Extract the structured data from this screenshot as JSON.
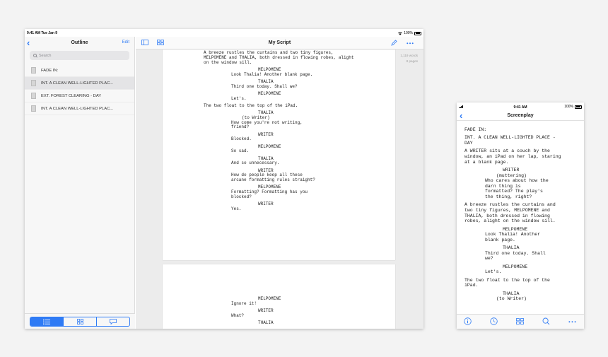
{
  "ipad": {
    "status": {
      "time": "9:41 AM  Tue Jan 9",
      "battery": "100%"
    },
    "sidebar": {
      "title": "Outline",
      "edit_label": "Edit",
      "search_placeholder": "Search",
      "items": [
        {
          "label": "FADE IN:"
        },
        {
          "label": "INT. A CLEAN WELL-LIGHTED PLAC..."
        },
        {
          "label": "EXT. FOREST CLEARING - DAY"
        },
        {
          "label": "INT. A CLEAN WELL-LIGHTED PLAC..."
        }
      ],
      "selected_index": 1,
      "segments": [
        "list-icon",
        "grid-icon",
        "comment-icon"
      ]
    },
    "main": {
      "title": "My Script",
      "stats": {
        "words": "1,119 words",
        "pages": "8 pages"
      },
      "page1": [
        {
          "text": "A breeze rustles the curtains and two tiny figures,",
          "type": "action"
        },
        {
          "text": "MELPOMENE and THALIA, both dressed in flowing robes, alight",
          "type": "action"
        },
        {
          "text": "on the window sill.",
          "type": "action"
        },
        {
          "text": "",
          "type": "blank"
        },
        {
          "text": "MELPOMENE",
          "type": "character"
        },
        {
          "text": "Look Thalia! Another blank page.",
          "type": "dialogue"
        },
        {
          "text": "",
          "type": "blank"
        },
        {
          "text": "THALIA",
          "type": "character"
        },
        {
          "text": "Third one today. Shall we?",
          "type": "dialogue"
        },
        {
          "text": "",
          "type": "blank"
        },
        {
          "text": "MELPOMENE",
          "type": "character"
        },
        {
          "text": "Let's.",
          "type": "dialogue"
        },
        {
          "text": "",
          "type": "blank"
        },
        {
          "text": "The two float to the top of the iPad.",
          "type": "action"
        },
        {
          "text": "",
          "type": "blank"
        },
        {
          "text": "THALIA",
          "type": "character"
        },
        {
          "text": "(to Writer)",
          "type": "paren"
        },
        {
          "text": "How come you're not writing,",
          "type": "dialogue"
        },
        {
          "text": "friend?",
          "type": "dialogue"
        },
        {
          "text": "",
          "type": "blank"
        },
        {
          "text": "WRITER",
          "type": "character"
        },
        {
          "text": "Blocked.",
          "type": "dialogue"
        },
        {
          "text": "",
          "type": "blank"
        },
        {
          "text": "MELPOMENE",
          "type": "character"
        },
        {
          "text": "So sad.",
          "type": "dialogue"
        },
        {
          "text": "",
          "type": "blank"
        },
        {
          "text": "THALIA",
          "type": "character"
        },
        {
          "text": "And so unnecessary.",
          "type": "dialogue"
        },
        {
          "text": "",
          "type": "blank"
        },
        {
          "text": "WRITER",
          "type": "character"
        },
        {
          "text": "How do people keep all these",
          "type": "dialogue"
        },
        {
          "text": "arcane formatting rules straight?",
          "type": "dialogue"
        },
        {
          "text": "",
          "type": "blank"
        },
        {
          "text": "MELPOMENE",
          "type": "character"
        },
        {
          "text": "Formatting? Formatting has you",
          "type": "dialogue"
        },
        {
          "text": "blocked?",
          "type": "dialogue"
        },
        {
          "text": "",
          "type": "blank"
        },
        {
          "text": "WRITER",
          "type": "character"
        },
        {
          "text": "Yes.",
          "type": "dialogue"
        }
      ],
      "page2": [
        {
          "text": "MELPOMENE",
          "type": "character"
        },
        {
          "text": "Ignore it!",
          "type": "dialogue"
        },
        {
          "text": "",
          "type": "blank"
        },
        {
          "text": "WRITER",
          "type": "character"
        },
        {
          "text": "What?",
          "type": "dialogue"
        },
        {
          "text": "",
          "type": "blank"
        },
        {
          "text": "THALIA",
          "type": "character"
        }
      ]
    }
  },
  "iphone": {
    "status": {
      "time": "9:41 AM",
      "battery": "100%"
    },
    "title": "Screenplay",
    "script": [
      {
        "text": "FADE IN:",
        "type": "action"
      },
      {
        "text": "",
        "type": "blank"
      },
      {
        "text": "INT. A CLEAN WELL-LIGHTED PLACE -",
        "type": "action"
      },
      {
        "text": "DAY",
        "type": "action"
      },
      {
        "text": "",
        "type": "blank"
      },
      {
        "text": "A WRITER sits at a couch by the",
        "type": "action"
      },
      {
        "text": "window, an iPad on her lap, staring",
        "type": "action"
      },
      {
        "text": "at a blank page.",
        "type": "action"
      },
      {
        "text": "",
        "type": "blank"
      },
      {
        "text": "WRITER",
        "type": "character"
      },
      {
        "text": "(muttering)",
        "type": "paren"
      },
      {
        "text": "Who cares about how the",
        "type": "dialogue"
      },
      {
        "text": "darn thing is",
        "type": "dialogue"
      },
      {
        "text": "formatted? The play's",
        "type": "dialogue"
      },
      {
        "text": "the thing, right?",
        "type": "dialogue"
      },
      {
        "text": "",
        "type": "blank"
      },
      {
        "text": "A breeze rustles the curtains and",
        "type": "action"
      },
      {
        "text": "two tiny figures, MELPOMENE and",
        "type": "action"
      },
      {
        "text": "THALIA, both dressed in flowing",
        "type": "action"
      },
      {
        "text": "robes, alight on the window sill.",
        "type": "action"
      },
      {
        "text": "",
        "type": "blank"
      },
      {
        "text": "MELPOMENE",
        "type": "character"
      },
      {
        "text": "Look Thalia! Another",
        "type": "dialogue"
      },
      {
        "text": "blank page.",
        "type": "dialogue"
      },
      {
        "text": "",
        "type": "blank"
      },
      {
        "text": "THALIA",
        "type": "character"
      },
      {
        "text": "Third one today. Shall",
        "type": "dialogue"
      },
      {
        "text": "we?",
        "type": "dialogue"
      },
      {
        "text": "",
        "type": "blank"
      },
      {
        "text": "MELPOMENE",
        "type": "character"
      },
      {
        "text": "Let's.",
        "type": "dialogue"
      },
      {
        "text": "",
        "type": "blank"
      },
      {
        "text": "The two float to the top of the",
        "type": "action"
      },
      {
        "text": "iPad.",
        "type": "action"
      },
      {
        "text": "",
        "type": "blank"
      },
      {
        "text": "THALIA",
        "type": "character"
      },
      {
        "text": "(to Writer)",
        "type": "paren"
      }
    ],
    "toolbar": [
      "info-icon",
      "clock-icon",
      "grid-icon",
      "search-icon",
      "more-icon"
    ]
  },
  "colors": {
    "accent": "#2f7bf5"
  }
}
